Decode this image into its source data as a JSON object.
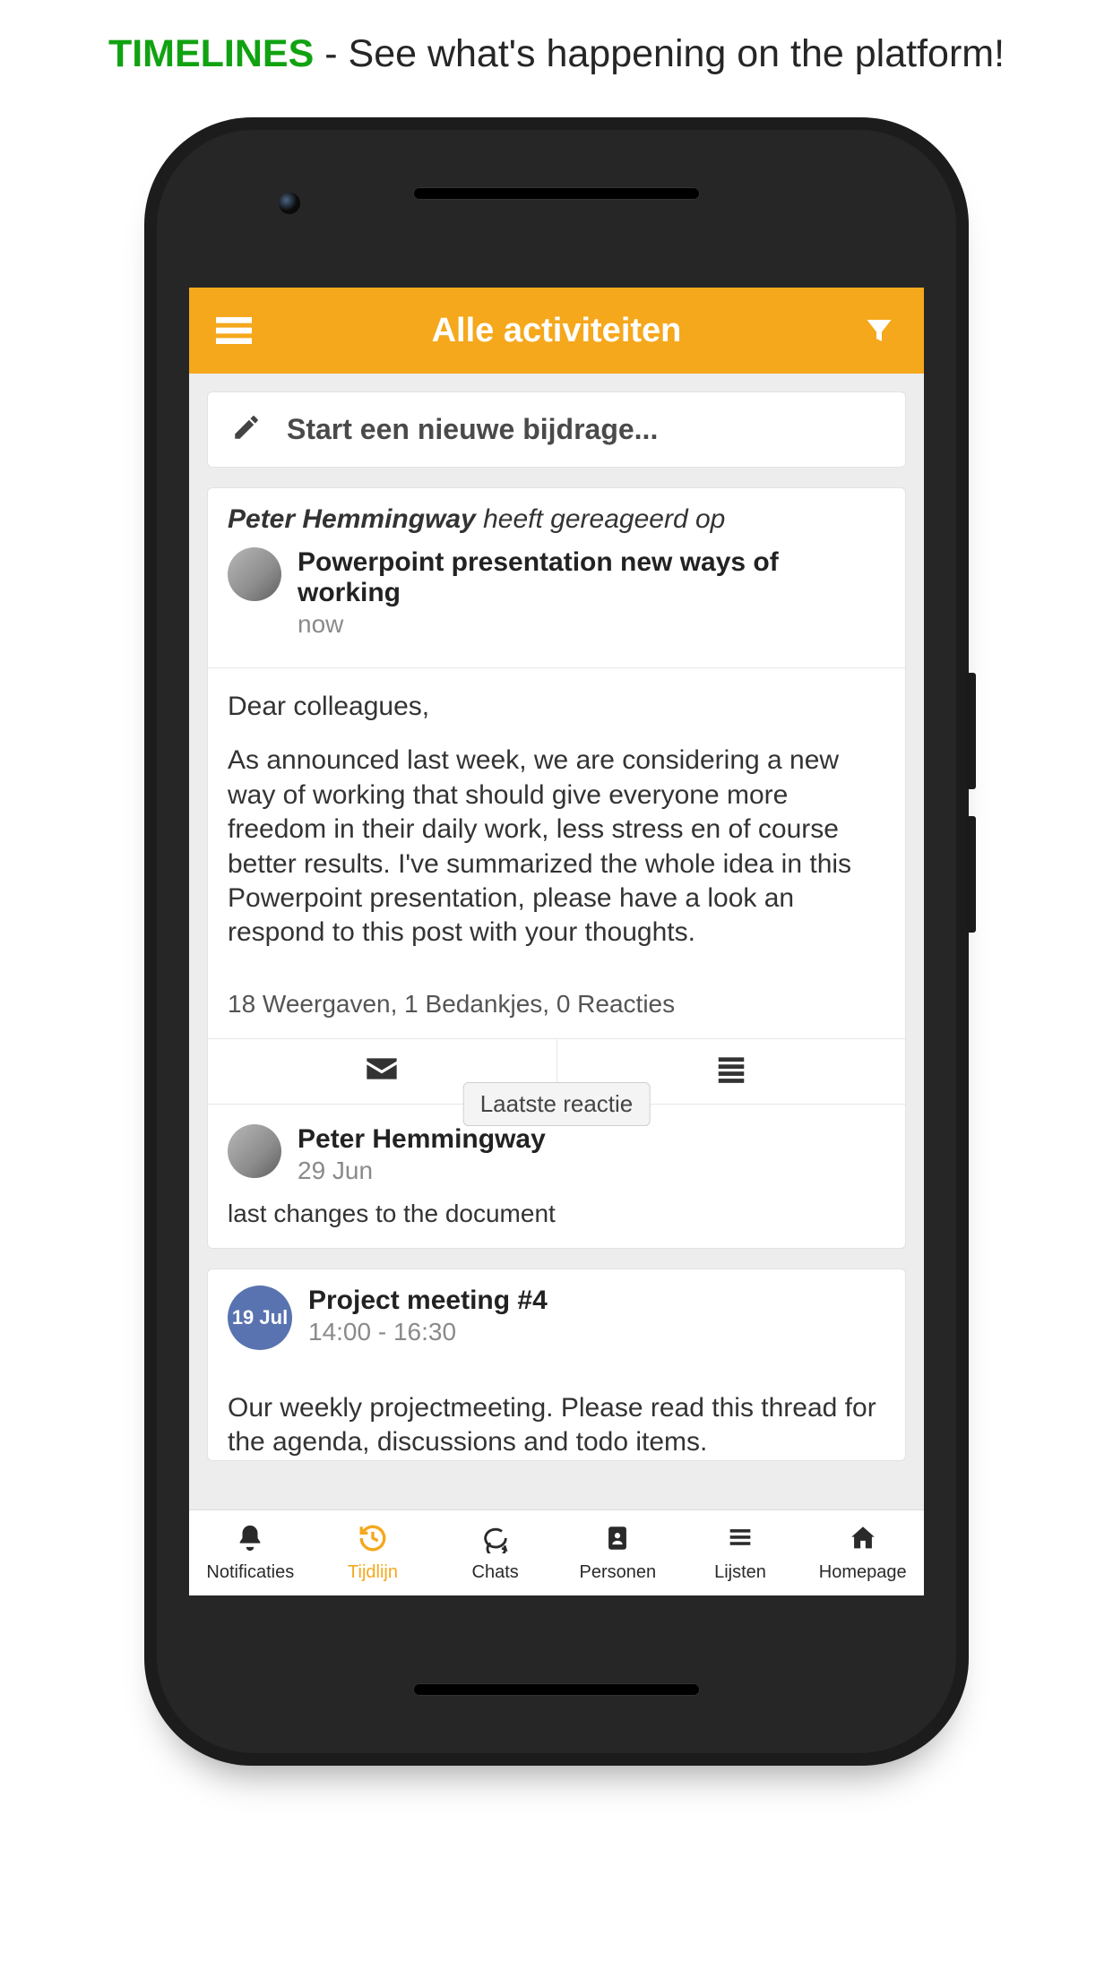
{
  "headline": {
    "bold": "TIMELINES",
    "rest": " - See what's happening on the platform!"
  },
  "appbar": {
    "title": "Alle activiteiten"
  },
  "compose": {
    "placeholder": "Start een nieuwe bijdrage..."
  },
  "post": {
    "actor": "Peter Hemmingway",
    "verb": "heeft gereageerd op",
    "title": "Powerpoint presentation new ways of working",
    "time": "now",
    "body_greeting": "Dear colleagues,",
    "body_main": "As announced last week, we are considering a new way of working that should give everyone more freedom in their daily work, less stress en of course better results. I've summarized the whole idea in this Powerpoint presentation, please have a look an respond to this post with your thoughts.",
    "stats": "18 Weergaven, 1 Bedankjes, 0 Reacties",
    "chip": "Laatste reactie",
    "reply": {
      "name": "Peter Hemmingway",
      "date": "29 Jun",
      "text": "last changes to the document"
    }
  },
  "event": {
    "badge": "19 Jul",
    "title": "Project meeting #4",
    "time": "14:00 - 16:30",
    "body": "Our weekly projectmeeting. Please read this thread for the agenda, discussions and todo items."
  },
  "tabs": {
    "notificaties": "Notificaties",
    "tijdlijn": "Tijdlijn",
    "chats": "Chats",
    "personen": "Personen",
    "lijsten": "Lijsten",
    "homepage": "Homepage"
  }
}
